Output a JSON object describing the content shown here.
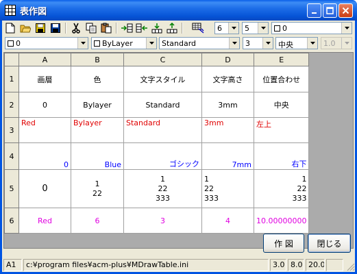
{
  "window": {
    "title": "表作図"
  },
  "toolbar2": {
    "layer_value": "0",
    "color_value": "ByLayer",
    "style_value": "Standard",
    "height_value": "3",
    "align_value": "中央",
    "ratio_value": "1.0"
  },
  "toolbar1": {
    "rows_value": "6",
    "cols_value": "5",
    "border_value": "0"
  },
  "grid": {
    "columns": [
      "A",
      "B",
      "C",
      "D",
      "E"
    ],
    "row_numbers": [
      "1",
      "2",
      "3",
      "4",
      "5",
      "6"
    ],
    "row1": [
      "画層",
      "色",
      "文字スタイル",
      "文字高さ",
      "位置合わせ"
    ],
    "row2": [
      "0",
      "Bylayer",
      "Standard",
      "3mm",
      "中央"
    ],
    "row3": [
      "Red",
      "Bylayer",
      "Standard",
      "3mm",
      "左上"
    ],
    "row4": [
      "0",
      "Blue",
      "ゴシック",
      "7mm",
      "右下"
    ],
    "row5": {
      "a": "0",
      "b": [
        "1",
        "22"
      ],
      "c": [
        "1",
        "22",
        "333"
      ],
      "d": [
        "1",
        "22",
        "333"
      ],
      "e": [
        "1",
        "22",
        "333"
      ]
    },
    "row6": [
      "Red",
      "6",
      "3",
      "4",
      "10.00000000"
    ]
  },
  "buttons": {
    "draw": "作 図",
    "close": "閉じる"
  },
  "status": {
    "cell": "A1",
    "path": "c:¥program files¥acm-plus¥MDrawTable.ini",
    "v1": "3.0",
    "v2": "8.0",
    "v3": "20.0"
  },
  "colors": {
    "red_text": "#e00000",
    "magenta_text": "#e000e0",
    "blue_text": "#0000ff"
  }
}
